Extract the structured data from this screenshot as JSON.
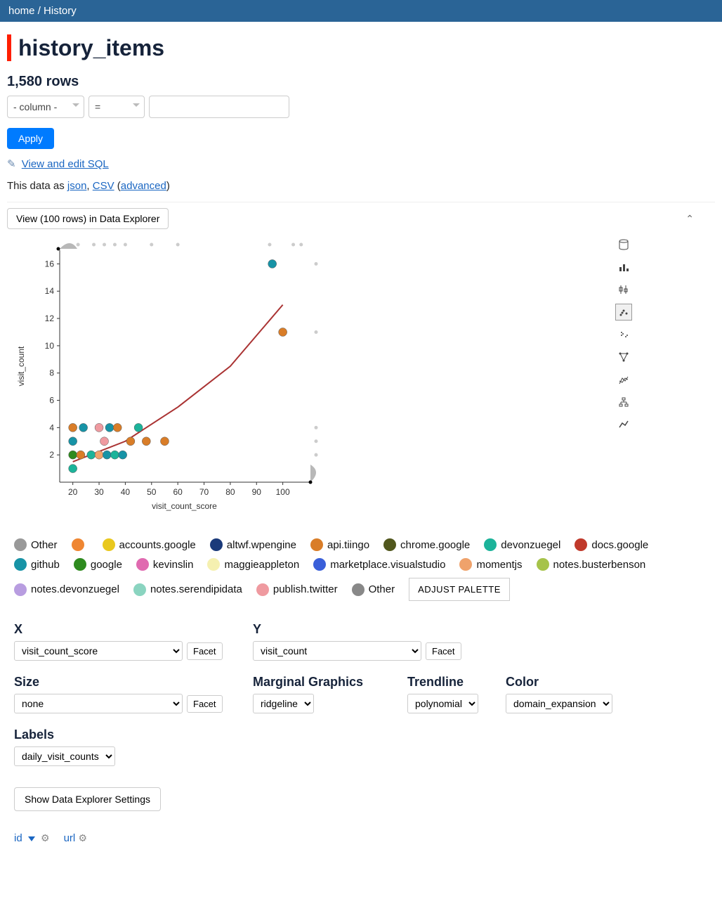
{
  "breadcrumb": {
    "home": "home",
    "sep": "/",
    "current": "History"
  },
  "title": "history_items",
  "row_count": "1,580 rows",
  "filter": {
    "column_placeholder": "- column -",
    "op": "="
  },
  "apply_label": "Apply",
  "sql_link": "View and edit SQL",
  "data_as": {
    "prefix": "This data as ",
    "json": "json",
    "csv": "CSV",
    "advanced": "advanced"
  },
  "view_button": "View (100 rows) in Data Explorer",
  "chart_data": {
    "type": "scatter",
    "xlabel": "visit_count_score",
    "ylabel": "visit_count",
    "xlim": [
      15,
      110
    ],
    "ylim": [
      0,
      17
    ],
    "xticks": [
      20,
      30,
      40,
      50,
      60,
      70,
      80,
      90,
      100
    ],
    "yticks": [
      2,
      4,
      6,
      8,
      10,
      12,
      14,
      16
    ],
    "points": [
      {
        "x": 20,
        "y": 4,
        "series": "api.tiingo"
      },
      {
        "x": 24,
        "y": 4,
        "series": "github"
      },
      {
        "x": 30,
        "y": 4,
        "series": "publish.twitter"
      },
      {
        "x": 34,
        "y": 4,
        "series": "github"
      },
      {
        "x": 37,
        "y": 4,
        "series": "api.tiingo"
      },
      {
        "x": 45,
        "y": 4,
        "series": "devonzuegel"
      },
      {
        "x": 20,
        "y": 3,
        "series": "github"
      },
      {
        "x": 32,
        "y": 3,
        "series": "publish.twitter"
      },
      {
        "x": 42,
        "y": 3,
        "series": "api.tiingo"
      },
      {
        "x": 48,
        "y": 3,
        "series": "api.tiingo"
      },
      {
        "x": 55,
        "y": 3,
        "series": "api.tiingo"
      },
      {
        "x": 20,
        "y": 2,
        "series": "google"
      },
      {
        "x": 23,
        "y": 2,
        "series": "api.tiingo"
      },
      {
        "x": 27,
        "y": 2,
        "series": "devonzuegel"
      },
      {
        "x": 30,
        "y": 2,
        "series": "momentjs"
      },
      {
        "x": 33,
        "y": 2,
        "series": "github"
      },
      {
        "x": 36,
        "y": 2,
        "series": "devonzuegel"
      },
      {
        "x": 39,
        "y": 2,
        "series": "github"
      },
      {
        "x": 20,
        "y": 1,
        "series": "devonzuegel"
      },
      {
        "x": 96,
        "y": 16,
        "series": "github"
      },
      {
        "x": 100,
        "y": 11,
        "series": "api.tiingo"
      }
    ],
    "marginal": "ridgeline",
    "trendline": "polynomial",
    "trend_points": [
      {
        "x": 20,
        "y": 1.5
      },
      {
        "x": 40,
        "y": 3
      },
      {
        "x": 60,
        "y": 5.5
      },
      {
        "x": 80,
        "y": 8.5
      },
      {
        "x": 100,
        "y": 13
      }
    ]
  },
  "legend": [
    {
      "label": "Other",
      "color": "#999999"
    },
    {
      "label": "",
      "color": "#ef8632"
    },
    {
      "label": "accounts.google",
      "color": "#e9c81e"
    },
    {
      "label": "altwf.wpengine",
      "color": "#1a3a7a"
    },
    {
      "label": "api.tiingo",
      "color": "#d97d28"
    },
    {
      "label": "chrome.google",
      "color": "#51571d"
    },
    {
      "label": "devonzuegel",
      "color": "#1cb39a"
    },
    {
      "label": "docs.google",
      "color": "#c0392b"
    },
    {
      "label": "github",
      "color": "#1793a6"
    },
    {
      "label": "google",
      "color": "#2e8b1f"
    },
    {
      "label": "kevinslin",
      "color": "#e06ab0"
    },
    {
      "label": "maggieappleton",
      "color": "#f5f0b0"
    },
    {
      "label": "marketplace.visualstudio",
      "color": "#3a5fd9"
    },
    {
      "label": "momentjs",
      "color": "#efa26b"
    },
    {
      "label": "notes.busterbenson",
      "color": "#a6c34a"
    },
    {
      "label": "notes.devonzuegel",
      "color": "#b89de0"
    },
    {
      "label": "notes.serendipidata",
      "color": "#8ad4c0"
    },
    {
      "label": "publish.twitter",
      "color": "#ef9aa0"
    },
    {
      "label": "Other",
      "color": "#888888"
    }
  ],
  "adjust_palette": "ADJUST PALETTE",
  "controls": {
    "x": {
      "label": "X",
      "value": "visit_count_score",
      "facet": "Facet"
    },
    "y": {
      "label": "Y",
      "value": "visit_count",
      "facet": "Facet"
    },
    "size": {
      "label": "Size",
      "value": "none",
      "facet": "Facet"
    },
    "marginal": {
      "label": "Marginal Graphics",
      "value": "ridgeline"
    },
    "trendline": {
      "label": "Trendline",
      "value": "polynomial"
    },
    "color": {
      "label": "Color",
      "value": "domain_expansion"
    },
    "labels": {
      "label": "Labels",
      "value": "daily_visit_counts"
    }
  },
  "settings_btn": "Show Data Explorer Settings",
  "columns": {
    "id": "id",
    "url": "url"
  },
  "tool_icons": [
    "database",
    "bar",
    "candle",
    "scatter",
    "cluster",
    "network",
    "parallel",
    "filter",
    "line"
  ]
}
